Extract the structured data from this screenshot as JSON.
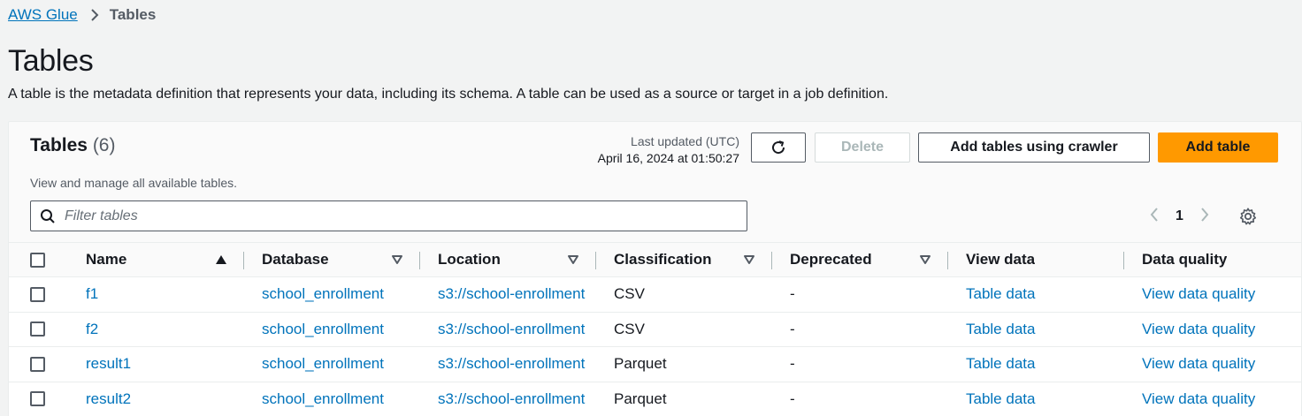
{
  "breadcrumb": {
    "root": "AWS Glue",
    "current": "Tables"
  },
  "page": {
    "title": "Tables",
    "description": "A table is the metadata definition that represents your data, including its schema. A table can be used as a source or target in a job definition."
  },
  "panel": {
    "title": "Tables",
    "count": "(6)",
    "subtitle": "View and manage all available tables.",
    "last_updated_label": "Last updated (UTC)",
    "last_updated_value": "April 16, 2024 at 01:50:27",
    "buttons": {
      "delete": "Delete",
      "add_crawler": "Add tables using crawler",
      "add_table": "Add table"
    },
    "filter_placeholder": "Filter tables",
    "pagination": {
      "current_page": "1"
    }
  },
  "table": {
    "headers": {
      "name": "Name",
      "database": "Database",
      "location": "Location",
      "classification": "Classification",
      "deprecated": "Deprecated",
      "view_data": "View data",
      "data_quality": "Data quality"
    },
    "rows": [
      {
        "name": "f1",
        "database": "school_enrollment",
        "location": "s3://school-enrollment",
        "classification": "CSV",
        "deprecated": "-",
        "view_data": "Table data",
        "data_quality": "View data quality"
      },
      {
        "name": "f2",
        "database": "school_enrollment",
        "location": "s3://school-enrollment",
        "classification": "CSV",
        "deprecated": "-",
        "view_data": "Table data",
        "data_quality": "View data quality"
      },
      {
        "name": "result1",
        "database": "school_enrollment",
        "location": "s3://school-enrollment",
        "classification": "Parquet",
        "deprecated": "-",
        "view_data": "Table data",
        "data_quality": "View data quality"
      },
      {
        "name": "result2",
        "database": "school_enrollment",
        "location": "s3://school-enrollment",
        "classification": "Parquet",
        "deprecated": "-",
        "view_data": "Table data",
        "data_quality": "View data quality"
      }
    ]
  },
  "colors": {
    "link": "#0073bb",
    "primary_button": "#ff9900",
    "text": "#16191f"
  }
}
